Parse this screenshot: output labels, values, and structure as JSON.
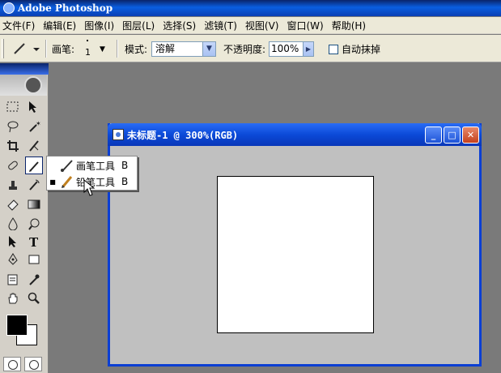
{
  "app": {
    "title": "Adobe Photoshop"
  },
  "menu": [
    "文件(F)",
    "编辑(E)",
    "图像(I)",
    "图层(L)",
    "选择(S)",
    "滤镜(T)",
    "视图(V)",
    "窗口(W)",
    "帮助(H)"
  ],
  "options": {
    "brush_label": "画笔:",
    "brush_size": "1",
    "mode_label": "模式:",
    "mode_value": "溶解",
    "opacity_label": "不透明度:",
    "opacity_value": "100%",
    "auto_erase_label": "自动抹掉",
    "auto_erase_checked": false
  },
  "flyout": {
    "items": [
      {
        "label": "画笔工具",
        "key": "B",
        "selected": false,
        "icon": "brush-icon"
      },
      {
        "label": "铅笔工具",
        "key": "B",
        "selected": true,
        "icon": "pencil-icon"
      }
    ]
  },
  "document": {
    "title": "未标题-1 @ 300%(RGB)"
  },
  "colors": {
    "foreground": "#000000",
    "background": "#ffffff",
    "accent": "#0b4ad8"
  }
}
